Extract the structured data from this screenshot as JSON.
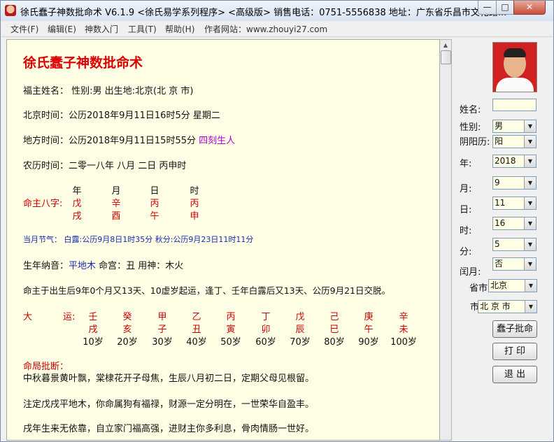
{
  "window": {
    "title": "徐氏蠢子神数批命术 V6.1.9 <徐氏易学系列程序> <高级版>   销售电话：0751-5556838   地址：广东省乐昌市文化路...",
    "min_glyph": "—",
    "max_glyph": "□",
    "close_glyph": "✕"
  },
  "menu": {
    "items": [
      "文件(F)",
      "编辑(E)",
      "神数入门",
      "工具(T)",
      "帮助(H)",
      "作者网站：www.zhouyi27.com"
    ]
  },
  "report": {
    "title": "徐氏蠢子神数批命术",
    "owner": "福主姓名：  性别:男   出生地:北京(北 京 市)",
    "beijing_time": "北京时间：公历2018年9月11日16时5分  星期二",
    "local_time": "地方时间：公历2018年9月11日15时55分",
    "local_time_note": "四刻生人",
    "lunar_time": "农历时间：二零一八年 八月 二日 丙申时",
    "bazi": {
      "label": "命主八字:",
      "headers": [
        "年",
        "月",
        "日",
        "时"
      ],
      "stems": [
        "戊",
        "辛",
        "丙",
        "丙"
      ],
      "branches": [
        "戌",
        "酉",
        "午",
        "申"
      ]
    },
    "solar_term": {
      "label": "当月节气：",
      "text": "白露:公历9月8日1时35分  秋分:公历9月23日11时11分"
    },
    "nayin": {
      "prefix": "生年纳音：",
      "value": "平地木",
      "rest": "命宫：丑   用神：木火"
    },
    "qiyun": "命主于出生后9年0个月又13天、10虚岁起运，逢丁、壬年白露后又13天、公历9月21日交脱。",
    "dayun": {
      "label_da": "大",
      "label_yun": "运:",
      "stems": [
        "壬",
        "癸",
        "甲",
        "乙",
        "丙",
        "丁",
        "戊",
        "己",
        "庚",
        "辛"
      ],
      "branches": [
        "戌",
        "亥",
        "子",
        "丑",
        "寅",
        "卯",
        "辰",
        "巳",
        "午",
        "未"
      ],
      "ages": [
        "10岁",
        "20岁",
        "30岁",
        "40岁",
        "50岁",
        "60岁",
        "70岁",
        "80岁",
        "90岁",
        "100岁"
      ]
    },
    "judgement_label": "命局批断：",
    "lines": [
      "中秋暮景黄叶飘，棠棣花开子母焦，生辰八月初二日，定期父母见根留。",
      "注定戊戌平地木，你命属狗有福禄，财源一定分明在，一世荣华自盈丰。",
      "戌年生来无依靠，自立家门福高强，进财主你多利息，骨肉情肠一世好。"
    ]
  },
  "form": {
    "name_label": "姓名:",
    "name_value": "",
    "gender_label": "性别:",
    "gender_value": "男",
    "calendar_label": "阴阳历:",
    "calendar_value": "阳",
    "year_label": "年:",
    "year_value": "2018",
    "month_label": "月:",
    "month_value": "9",
    "day_label": "日:",
    "day_value": "11",
    "hour_label": "时:",
    "hour_value": "16",
    "minute_label": "分:",
    "minute_value": "5",
    "leap_label": "闰月:",
    "leap_value": "否",
    "province_label": "省市",
    "province_value": "北京",
    "city_label": "市",
    "city_value": "北 京 市",
    "btn_calc": "蠢子批命",
    "btn_print": "打  印",
    "btn_exit": "退  出"
  },
  "colors": {
    "paper": "#ffffe6",
    "red_text": "#cc0000",
    "blue_text": "#1a2ab0",
    "purple_text": "#b000c8"
  }
}
